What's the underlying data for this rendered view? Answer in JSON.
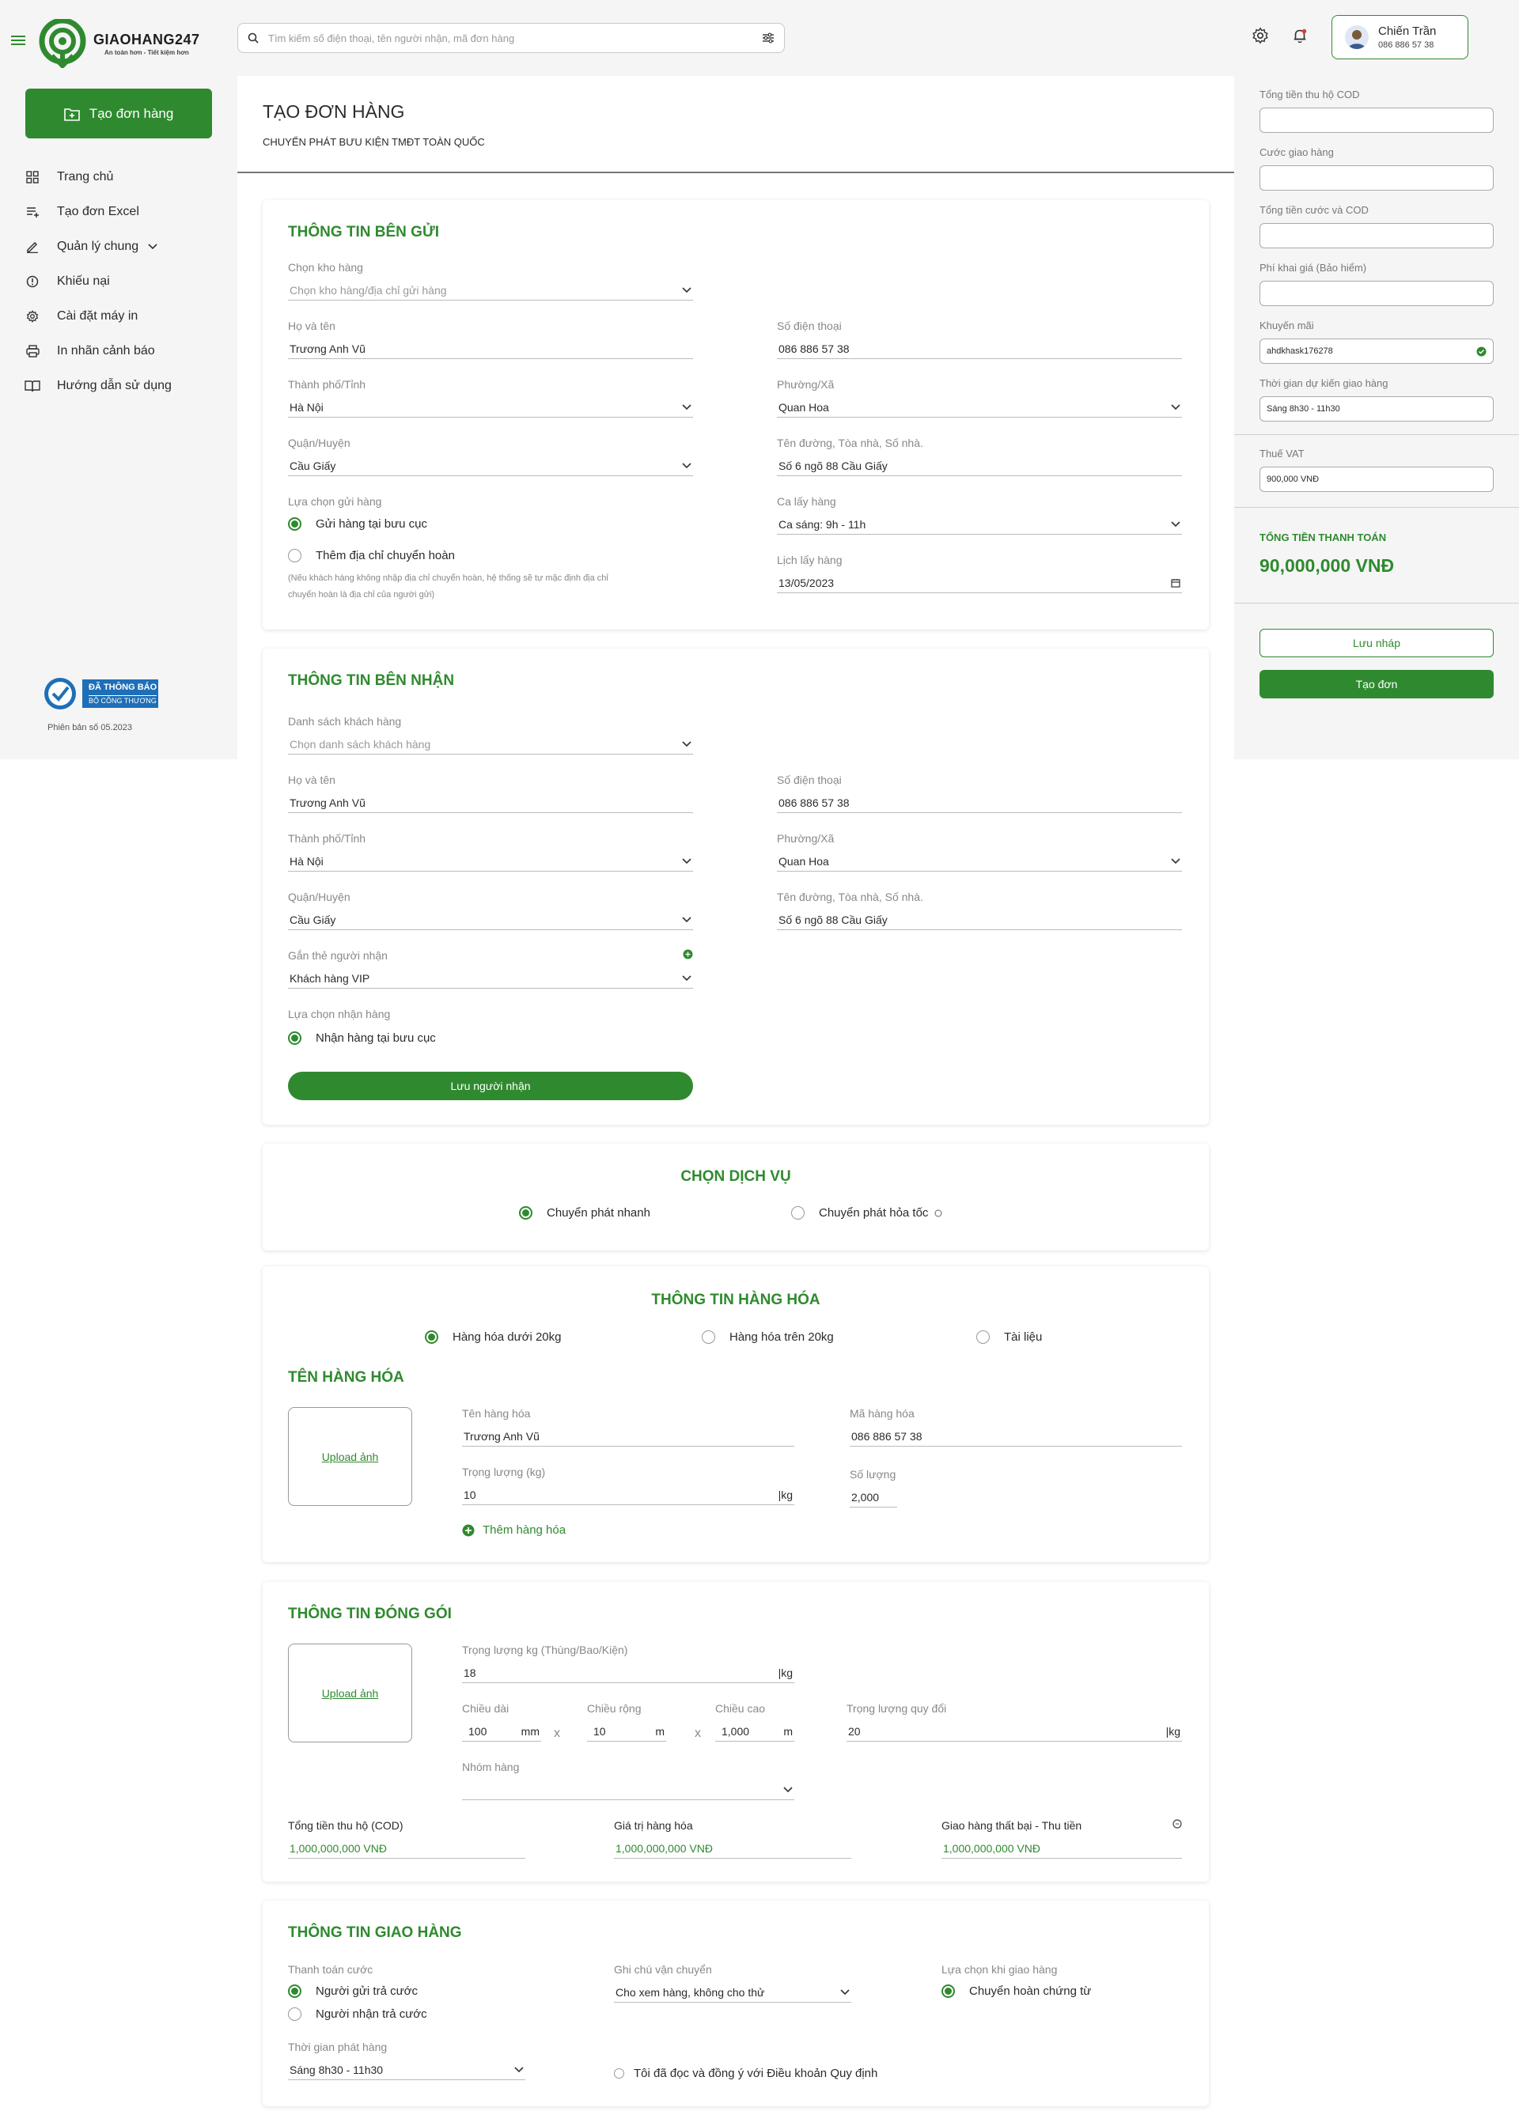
{
  "header": {
    "logo_name": "GIAOHANG247",
    "logo_slogan": "An toàn hơn - Tiết kiệm hơn",
    "search_placeholder": "Tìm kiếm số điện thoại, tên người nhận, mã đơn hàng",
    "user_name": "Chiến Trần",
    "user_phone": "086 886 57 38"
  },
  "sidebar": {
    "create_label": "Tạo đơn hàng",
    "items": [
      {
        "label": "Trang chủ",
        "icon": "grid-icon"
      },
      {
        "label": "Tạo đơn Excel",
        "icon": "list-add-icon"
      },
      {
        "label": "Quản lý chung",
        "icon": "edit-icon"
      },
      {
        "label": "Khiếu nại",
        "icon": "alert-circle-icon"
      },
      {
        "label": "Cài đặt máy in",
        "icon": "gear-icon"
      },
      {
        "label": "In nhãn cảnh báo",
        "icon": "printer-icon"
      },
      {
        "label": "Hướng dẫn sử dụng",
        "icon": "book-icon"
      }
    ],
    "badge_line1": "ĐÃ THÔNG BÁO",
    "badge_line2": "BỘ CÔNG THƯƠNG",
    "version": "Phiên bản số 05.2023"
  },
  "page": {
    "title": "TẠO ĐƠN HÀNG",
    "subtitle": "CHUYỂN PHÁT BƯU KIỆN TMĐT TOÀN QUỐC"
  },
  "sender": {
    "title": "THÔNG TIN BÊN GỬI",
    "warehouse_label": "Chọn kho hàng",
    "warehouse_placeholder": "Chọn kho hàng/địa chỉ gửi hàng",
    "name_label": "Họ và tên",
    "name_value": "Trương Anh Vũ",
    "phone_label": "Số điện thoại",
    "phone_value": "086 886 57 38",
    "city_label": "Thành phố/Tỉnh",
    "city_value": "Hà Nội",
    "ward_label": "Phường/Xã",
    "ward_value": "Quan Hoa",
    "district_label": "Quận/Huyện",
    "district_value": "Cầu Giấy",
    "street_label": "Tên đường, Tòa nhà, Số nhà.",
    "street_value": "Số 6 ngõ 88 Cầu Giấy",
    "send_option_label": "Lựa chọn gửi hàng",
    "send_option_1": "Gửi hàng tại bưu cục",
    "send_option_2": "Thêm địa chỉ chuyển hoàn",
    "note_line1": "(Nếu khách hàng không nhập địa chỉ chuyển hoàn, hệ thống sẽ tự mặc định địa chỉ",
    "note_line2": "chuyển hoàn là địa chỉ của người gửi)",
    "shift_label": "Ca lấy hàng",
    "shift_value": "Ca sáng: 9h - 11h",
    "pickup_label": "Lịch lấy hàng",
    "pickup_value": "13/05/2023"
  },
  "receiver": {
    "title": "THÔNG TIN BÊN NHẬN",
    "list_label": "Danh sách khách hàng",
    "list_placeholder": "Chọn danh sách khách hàng",
    "name_label": "Họ và tên",
    "name_value": "Trương Anh Vũ",
    "phone_label": "Số điện thoại",
    "phone_value": "086 886 57 38",
    "city_label": "Thành phố/Tỉnh",
    "city_value": "Hà Nội",
    "ward_label": "Phường/Xã",
    "ward_value": "Quan Hoa",
    "district_label": "Quận/Huyện",
    "district_value": "Cầu Giấy",
    "street_label": "Tên đường, Tòa nhà, Số nhà.",
    "street_value": "Số 6 ngõ 88 Cầu Giấy",
    "tag_label": "Gắn thẻ người nhận",
    "tag_value": "Khách hàng VIP",
    "receive_option_label": "Lựa chọn nhận hàng",
    "receive_option_1": "Nhận hàng tại bưu cục",
    "save_button": "Lưu người nhận"
  },
  "service": {
    "title": "CHỌN DỊCH VỤ",
    "option_1": "Chuyển phát nhanh",
    "option_2": "Chuyển phát hỏa tốc"
  },
  "goods": {
    "title": "THÔNG TIN HÀNG HÓA",
    "type_1": "Hàng hóa dưới 20kg",
    "type_2": "Hàng hóa trên 20kg",
    "type_3": "Tài liệu",
    "subtitle": "TÊN HÀNG HÓA",
    "upload": "Upload ảnh",
    "name_label": "Tên hàng hóa",
    "name_value": "Trương Anh Vũ",
    "code_label": "Mã hàng hóa",
    "code_value": "086 886 57 38",
    "weight_label": "Trọng lượng (kg)",
    "weight_value": "10",
    "weight_unit": "|kg",
    "qty_label": "Số lượng",
    "qty_value": "2,000",
    "add_label": "Thêm hàng hóa"
  },
  "packing": {
    "title": "THÔNG TIN ĐÓNG GÓI",
    "upload": "Upload ảnh",
    "weight_label": "Trọng lượng kg (Thùng/Bao/Kiện)",
    "weight_value": "18",
    "weight_unit": "|kg",
    "length_label": "Chiều dài",
    "length_value": "100",
    "length_unit": "mm",
    "width_label": "Chiều rộng",
    "width_value": "10",
    "width_unit": "m",
    "height_label": "Chiều cao",
    "height_value": "1,000",
    "height_unit": "m",
    "x_sign": "x",
    "conv_label": "Trọng lượng quy đổi",
    "conv_value": "20",
    "conv_unit": "|kg",
    "group_label": "Nhóm hàng",
    "cod_label": "Tổng tiền thu hộ (COD)",
    "cod_value": "1,000,000,000 VNĐ",
    "goods_value_label": "Giá trị hàng hóa",
    "goods_value": "1,000,000,000 VNĐ",
    "fail_label": "Giao hàng thất bại - Thu tiền",
    "fail_value": "1,000,000,000 VNĐ"
  },
  "delivery": {
    "title": "THÔNG TIN GIAO HÀNG",
    "fee_label": "Thanh toán cước",
    "fee_option_1": "Người gửi trả cước",
    "fee_option_2": "Người nhận trả cước",
    "note_label": "Ghi chú vận chuyển",
    "note_value": "Cho xem hàng, không cho thử",
    "fail_option_label": "Lựa chọn khi giao hàng",
    "fail_option_1": "Chuyển hoàn chứng từ",
    "time_label": "Thời gian phát hàng",
    "time_value": "Sáng 8h30 - 11h30",
    "agree": "Tôi đã đọc và đồng ý với Điều khoản Quy định"
  },
  "summary": {
    "cod_total_label": "Tổng tiền thu hộ COD",
    "shipping_label": "Cước giao hàng",
    "fee_cod_label": "Tổng tiền cước và COD",
    "insurance_label": "Phí khai giá (Bảo hiểm)",
    "promo_label": "Khuyến mãi",
    "promo_value": "ahdkhask176278",
    "eta_label": "Thời gian dự kiến giao hàng",
    "eta_value": "Sáng 8h30 - 11h30",
    "vat_label": "Thuế VAT",
    "vat_value": "900,000 VNĐ",
    "total_label": "TỔNG TIỀN THANH TOÁN",
    "total_value": "90,000,000 VNĐ",
    "draft_button": "Lưu nháp",
    "create_button": "Tạo đơn"
  },
  "colors": {
    "accent": "#2f8a2f",
    "panel": "#f5f5f5"
  }
}
